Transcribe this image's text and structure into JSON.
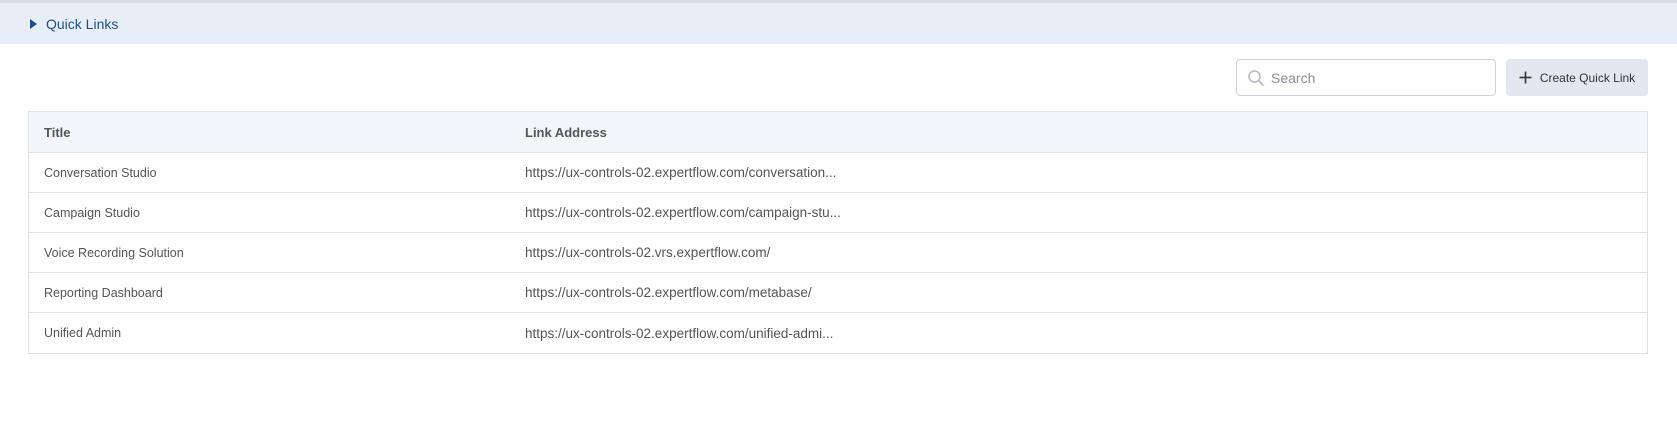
{
  "accordion": {
    "title": "Quick Links",
    "expanded": false
  },
  "toolbar": {
    "search_placeholder": "Search",
    "search_value": "",
    "create_label": "Create Quick Link"
  },
  "table": {
    "columns": [
      "Title",
      "Link Address"
    ],
    "rows": [
      {
        "title": "Conversation Studio",
        "link": "https://ux-controls-02.expertflow.com/conversation..."
      },
      {
        "title": "Campaign Studio",
        "link": "https://ux-controls-02.expertflow.com/campaign-stu..."
      },
      {
        "title": "Voice Recording Solution",
        "link": "https://ux-controls-02.vrs.expertflow.com/"
      },
      {
        "title": "Reporting Dashboard",
        "link": "https://ux-controls-02.expertflow.com/metabase/"
      },
      {
        "title": "Unified Admin",
        "link": "https://ux-controls-02.expertflow.com/unified-admi..."
      }
    ]
  },
  "colors": {
    "accent": "#1f4e96",
    "accordion_bg": "#e8eef7",
    "header_bg": "#f2f5f9",
    "button_bg": "#e3e8f0",
    "border": "#dfe3e8"
  },
  "icons": {
    "caret": "caret-right-icon",
    "search": "search-icon",
    "plus": "plus-icon"
  }
}
